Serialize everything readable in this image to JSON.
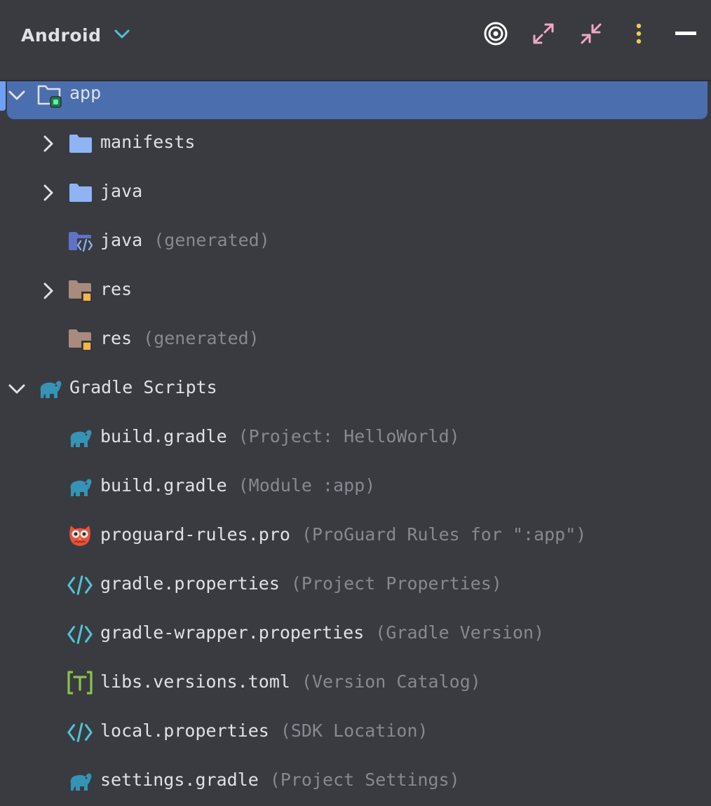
{
  "header": {
    "view_label": "Android",
    "icons": [
      "locate-icon",
      "expand-all-icon",
      "collapse-all-icon",
      "more-options-icon",
      "hide-icon"
    ]
  },
  "tree": {
    "app": {
      "label": "app"
    },
    "manifests": {
      "label": "manifests"
    },
    "java": {
      "label": "java"
    },
    "java_generated": {
      "label": "java",
      "hint": "(generated)"
    },
    "res": {
      "label": "res"
    },
    "res_generated": {
      "label": "res",
      "hint": "(generated)"
    },
    "gradle_scripts": {
      "label": "Gradle Scripts"
    },
    "build_gradle_project": {
      "label": "build.gradle",
      "hint": "(Project: HelloWorld)"
    },
    "build_gradle_module": {
      "label": "build.gradle",
      "hint": "(Module :app)"
    },
    "proguard": {
      "label": "proguard-rules.pro",
      "hint": "(ProGuard Rules for \":app\")"
    },
    "gradle_properties": {
      "label": "gradle.properties",
      "hint": "(Project Properties)"
    },
    "gradle_wrapper": {
      "label": "gradle-wrapper.properties",
      "hint": "(Gradle Version)"
    },
    "libs_versions": {
      "label": "libs.versions.toml",
      "hint": "(Version Catalog)"
    },
    "local_properties": {
      "label": "local.properties",
      "hint": "(SDK Location)"
    },
    "settings_gradle": {
      "label": "settings.gradle",
      "hint": "(Project Settings)"
    }
  },
  "colors": {
    "background": "#393b40",
    "selection": "#4b6eaf",
    "folder_blue": "#8fb4f4",
    "folder_res": "#a88b7c",
    "gradle_teal": "#3593b5",
    "accent_cyan": "#4fc3d5",
    "expand_pink": "#f0a8c8",
    "more_yellow": "#f2c94c"
  }
}
